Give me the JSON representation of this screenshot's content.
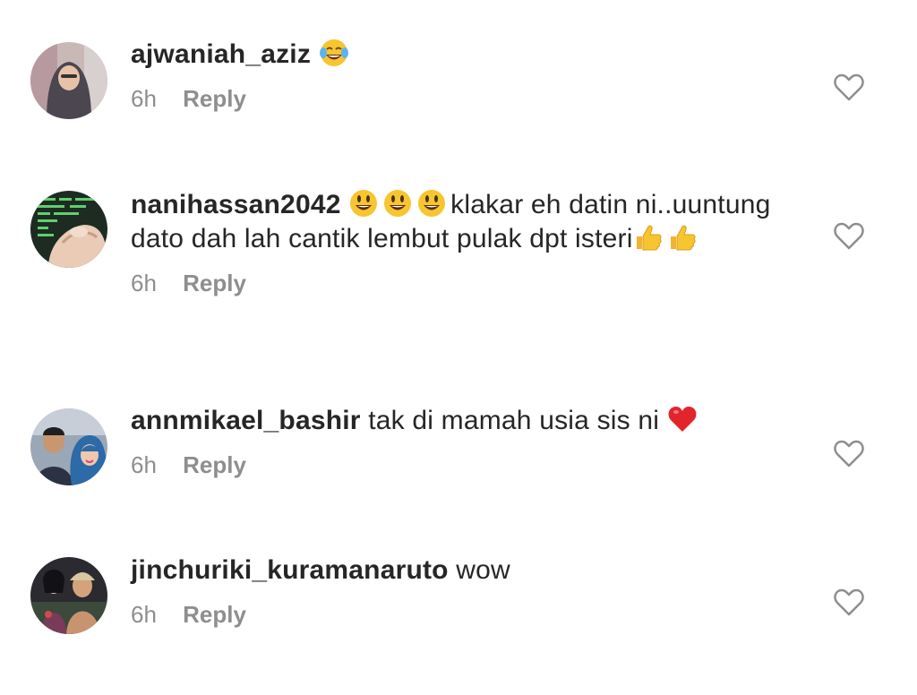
{
  "comments": [
    {
      "username": "ajwaniah_aziz",
      "text_before": "",
      "emojis_before": [],
      "text": "",
      "emojis_after": [
        "tears-of-joy-emoji"
      ],
      "text_after": "",
      "time": "6h",
      "reply_label": "Reply",
      "avatar": "hijab-portrait"
    },
    {
      "username": "nanihassan2042",
      "emojis_before": [
        "smiley-emoji",
        "smiley-emoji",
        "smiley-emoji"
      ],
      "text": "klakar eh datin ni..uuntung dato dah lah cantik lembut pulak dpt isteri",
      "emojis_after": [
        "thumbs-up-emoji",
        "thumbs-up-emoji"
      ],
      "time": "6h",
      "reply_label": "Reply",
      "avatar": "hand-on-screen"
    },
    {
      "username": "annmikael_bashir",
      "emojis_before": [],
      "text": "tak di mamah usia sis ni",
      "emojis_after": [
        "red-heart-emoji"
      ],
      "time": "6h",
      "reply_label": "Reply",
      "avatar": "couple-selfie"
    },
    {
      "username": "jinchuriki_kuramanaruto",
      "emojis_before": [],
      "text": "wow",
      "emojis_after": [],
      "time": "6h",
      "reply_label": "Reply",
      "avatar": "dark-poster"
    }
  ],
  "colors": {
    "text": "#262626",
    "muted": "#8e8e8e",
    "icon": "#8e8e8e"
  },
  "icons": {
    "like": "heart-outline-icon"
  }
}
